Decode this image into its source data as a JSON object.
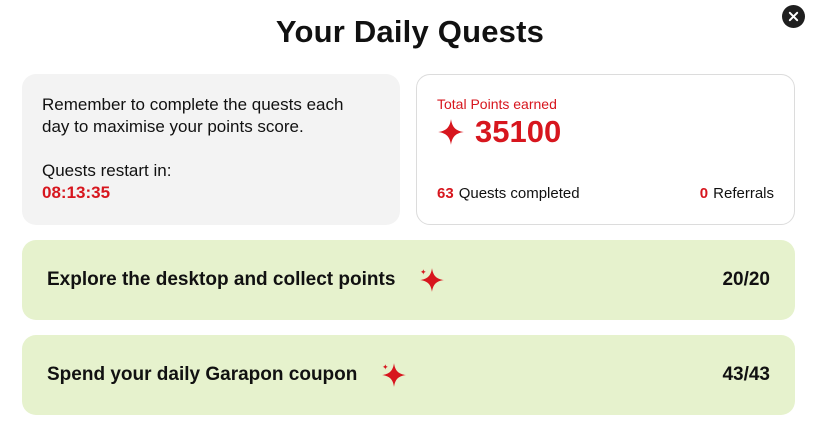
{
  "modal": {
    "title": "Your Daily Quests"
  },
  "info": {
    "reminder": "Remember to complete the quests each day to maximise your points score.",
    "restart_label": "Quests restart in:",
    "countdown": "08:13:35"
  },
  "points": {
    "label": "Total Points earned",
    "total": "35100",
    "quests_completed_count": "63",
    "quests_completed_label": "Quests completed",
    "referrals_count": "0",
    "referrals_label": "Referrals"
  },
  "quests": [
    {
      "label": "Explore the desktop and collect points",
      "progress": "20/20"
    },
    {
      "label": "Spend your daily Garapon coupon",
      "progress": "43/43"
    }
  ],
  "icons": {
    "close": "close-icon",
    "sparkle": "sparkle-icon"
  },
  "colors": {
    "accent_red": "#d7161e",
    "quest_bg": "#e6f2cd",
    "info_bg": "#f3f3f3",
    "close_bg": "#1f1f1f"
  }
}
